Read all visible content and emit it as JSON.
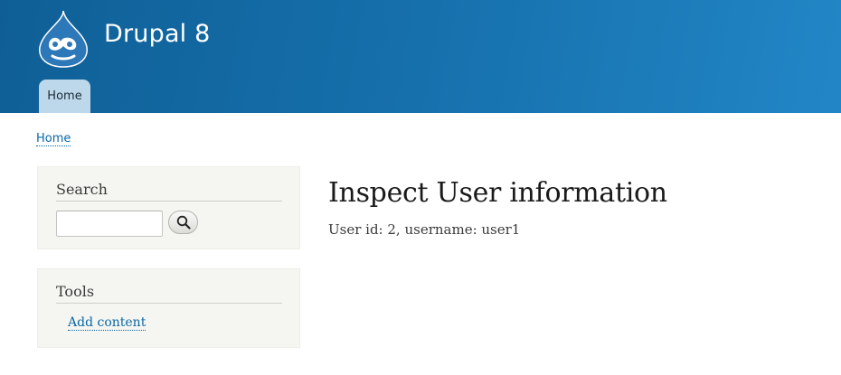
{
  "site": {
    "name": "Drupal 8",
    "logo_icon": "drupal-drop-icon"
  },
  "nav": {
    "tabs": [
      {
        "label": "Home",
        "active": true
      }
    ]
  },
  "breadcrumb": {
    "items": [
      "Home"
    ]
  },
  "sidebar": {
    "search": {
      "title": "Search",
      "input_value": "",
      "button_icon": "magnifier-icon"
    },
    "tools": {
      "title": "Tools",
      "links": [
        "Add content"
      ]
    }
  },
  "main": {
    "title": "Inspect User information",
    "body": "User id: 2, username: user1"
  },
  "colors": {
    "header_start": "#0f5f96",
    "header_end": "#2286c6",
    "active_tab": "#bcd8ea",
    "link": "#0a67a7",
    "sidebar_bg": "#f5f5f1"
  }
}
